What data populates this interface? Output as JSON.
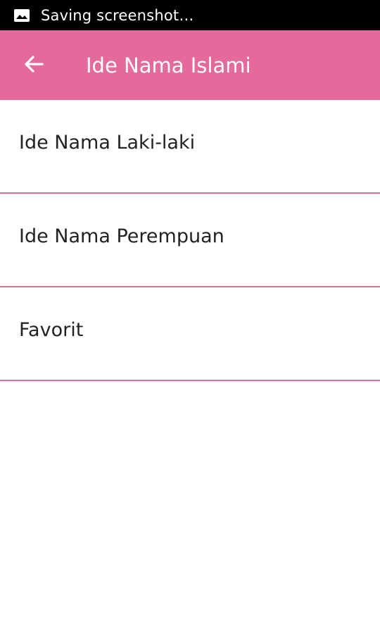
{
  "colors": {
    "primary": "#e46a9b",
    "divider": "#e46a9b",
    "status_bar": "#000000"
  },
  "status_bar": {
    "notification_icon": "image-icon",
    "notification_text": "Saving screenshot…"
  },
  "toolbar": {
    "back_icon": "arrow-left-icon",
    "title": "Ide Nama Islami"
  },
  "menu": {
    "items": [
      {
        "label": "Ide Nama Laki-laki"
      },
      {
        "label": "Ide Nama Perempuan"
      },
      {
        "label": "Favorit"
      }
    ]
  }
}
